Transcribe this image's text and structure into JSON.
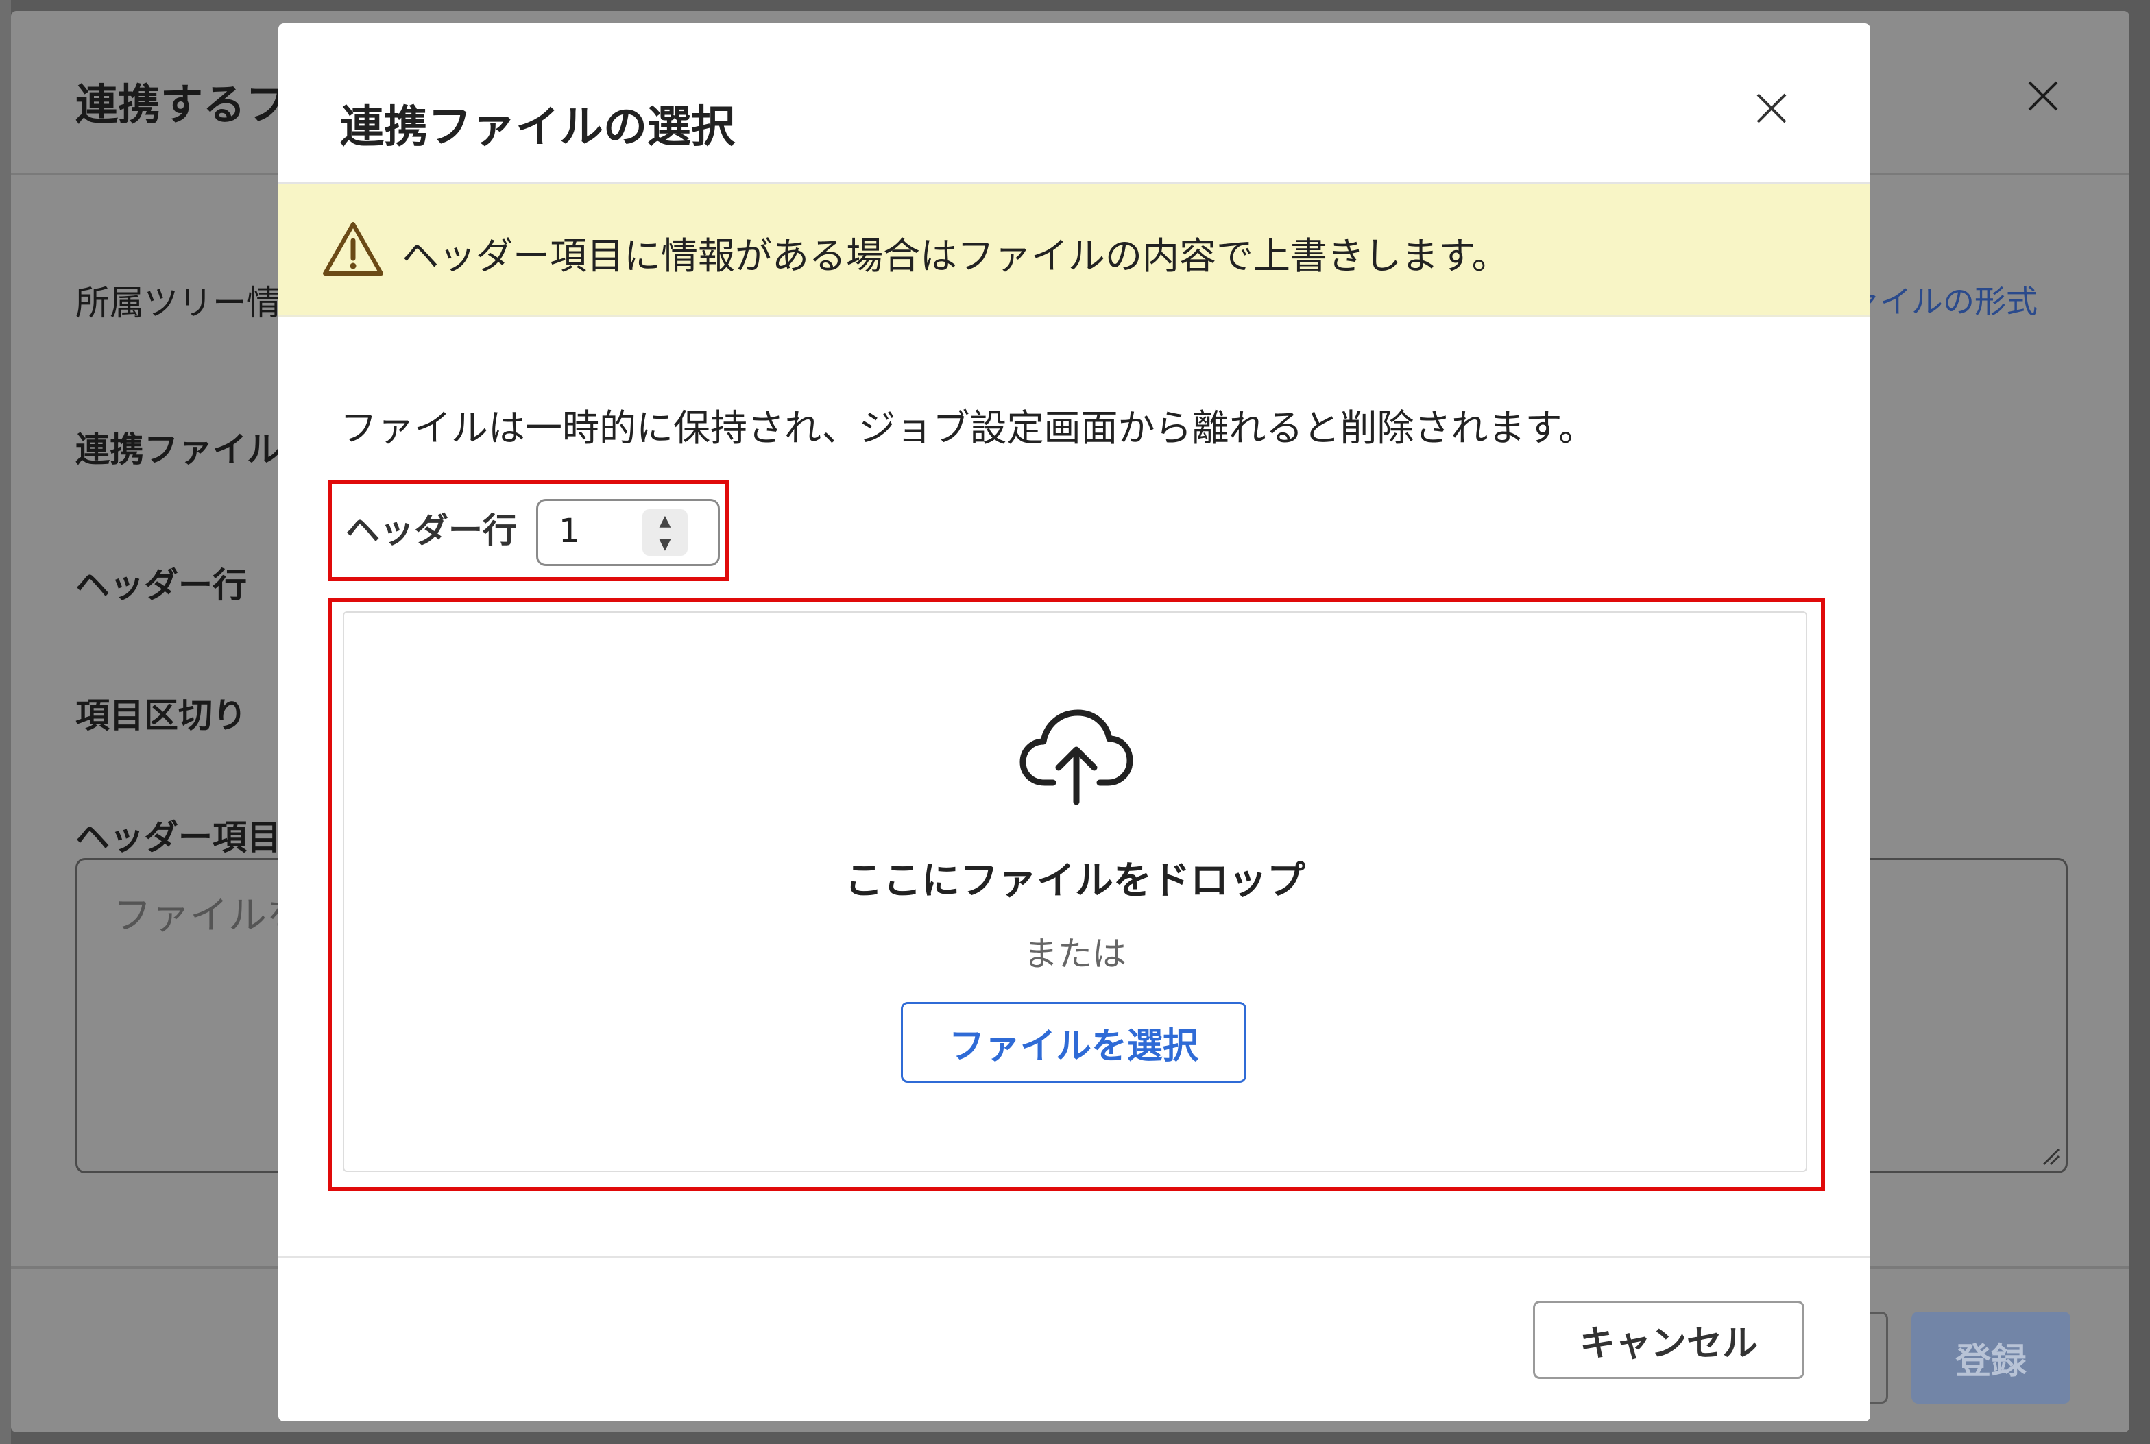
{
  "background_dialog": {
    "title": "連携するフ",
    "field_labels": {
      "tree": "所属ツリー情",
      "file": "連携ファイル",
      "header_row": "ヘッダー行",
      "delimiter": "項目区切り",
      "header_items": "ヘッダー項目"
    },
    "required_mark": "*",
    "format_link": "ァイルの形式",
    "textarea_placeholder": "ファイルを",
    "register_label": "登録"
  },
  "modal": {
    "title": "連携ファイルの選択",
    "warning": "ヘッダー項目に情報がある場合はファイルの内容で上書きします。",
    "info": "ファイルは一時的に保持され、ジョブ設定画面から離れると削除されます。",
    "header_row": {
      "label": "ヘッダー行",
      "value": "1"
    },
    "drop_zone": {
      "title": "ここにファイルをドロップ",
      "or": "または",
      "select_button": "ファイルを選択"
    },
    "cancel_button": "キャンセル"
  },
  "colors": {
    "accent": "#2f6bd6",
    "highlight_border": "#e00a0a",
    "warning_bg": "#f8f5c6"
  }
}
